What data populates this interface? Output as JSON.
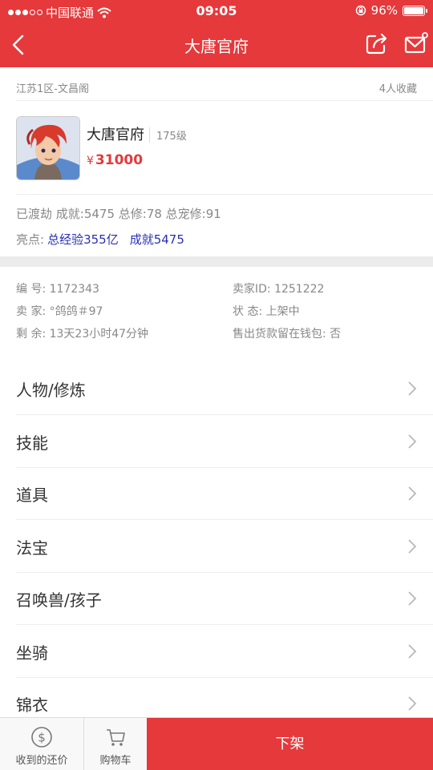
{
  "status_bar": {
    "carrier": "中国联通",
    "time": "09:05",
    "battery": "96%"
  },
  "nav": {
    "title": "大唐官府"
  },
  "header": {
    "server": "江苏1区-文昌阁",
    "favorites": "4人收藏"
  },
  "product": {
    "name": "大唐官府",
    "level": "175级",
    "currency": "¥",
    "price": "31000"
  },
  "stats": "已渡劫 成就:5475 总修:78 总宠修:91",
  "highlight": {
    "label": "亮点:",
    "values": [
      "总经验355亿",
      "成就5475"
    ]
  },
  "details": {
    "number": "编  号: 1172343",
    "seller_id": "卖家ID: 1251222",
    "seller": "卖  家: °鸽鸽＃97",
    "status": "状  态: 上架中",
    "remaining": "剩  余: 13天23小时47分钟",
    "wallet": "售出货款留在钱包: 否"
  },
  "list_items": [
    {
      "label": "人物/修炼"
    },
    {
      "label": "技能"
    },
    {
      "label": "道具"
    },
    {
      "label": "法宝"
    },
    {
      "label": "召唤兽/孩子"
    },
    {
      "label": "坐骑"
    },
    {
      "label": "锦衣"
    }
  ],
  "bottom_bar": {
    "offers_label": "收到的还价",
    "cart_label": "购物车",
    "action_label": "下架"
  },
  "colors": {
    "accent": "#e5393b",
    "highlight": "#2a2fb4"
  }
}
